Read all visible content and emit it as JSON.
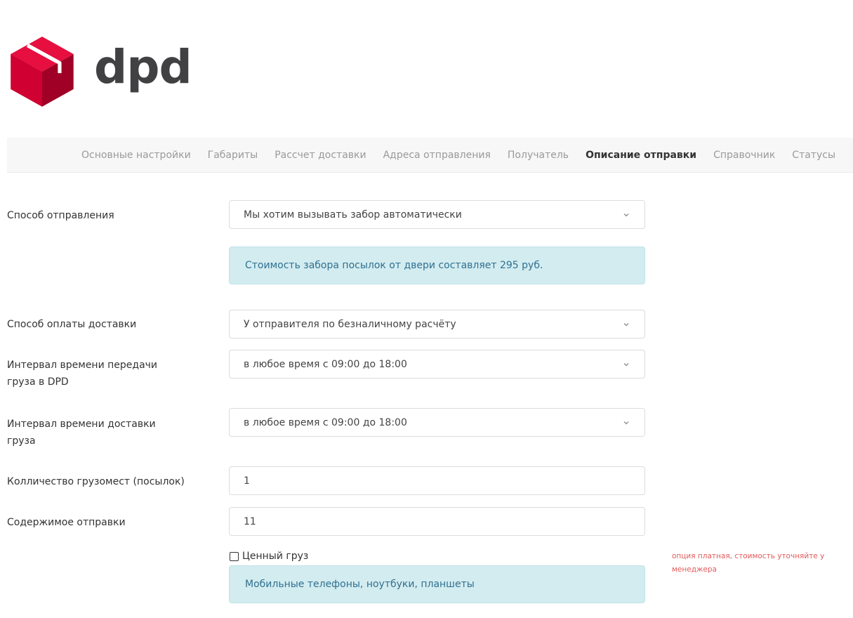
{
  "logo": {
    "text": "dpd",
    "brand_color": "#dc0032",
    "text_color": "#414042"
  },
  "tabs": [
    {
      "label": "Основные настройки",
      "active": false
    },
    {
      "label": "Габариты",
      "active": false
    },
    {
      "label": "Рассчет доставки",
      "active": false
    },
    {
      "label": "Адреса отправления",
      "active": false
    },
    {
      "label": "Получатель",
      "active": false
    },
    {
      "label": "Описание отправки",
      "active": true
    },
    {
      "label": "Справочник",
      "active": false
    },
    {
      "label": "Статусы",
      "active": false
    }
  ],
  "form": {
    "shipping_method": {
      "label": "Способ отправления",
      "value": "Мы хотим вызывать забор автоматически"
    },
    "pickup_info": "Стоимость забора посылок от двери составляет 295 руб.",
    "payment_method": {
      "label": "Способ оплаты доставки",
      "value": "У отправителя по безналичному расчёту"
    },
    "handover_interval": {
      "label": "Интервал времени передачи груза в DPD",
      "value": "в любое время с 09:00 до 18:00"
    },
    "delivery_interval": {
      "label": "Интервал времени доставки груза",
      "value": "в любое время с 09:00 до 18:00"
    },
    "parcel_count": {
      "label": "Колличество грузомест (посылок)",
      "value": "1"
    },
    "contents": {
      "label": "Содержимое отправки",
      "value": "11"
    },
    "valuable_cargo": {
      "label": "Ценный груз",
      "checked": false
    },
    "valuable_note": "опция платная, стоимость уточняйте у менеджера",
    "contents_info": "Мобильные телефоны, ноутбуки, планшеты"
  },
  "colors": {
    "info_bg": "#d2ecf0",
    "info_text": "#31708f",
    "note_text": "#e35b5b"
  }
}
